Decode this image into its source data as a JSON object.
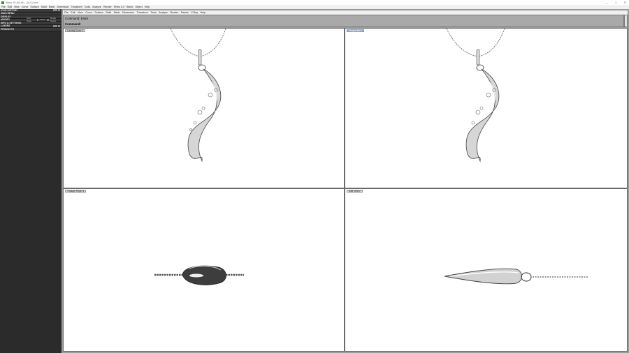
{
  "window": {
    "title": "Rhino 3D (64-bit) - [ALC] Jiem",
    "buttons": [
      "—",
      "□",
      "✕"
    ]
  },
  "top_menu": [
    "File",
    "Edit",
    "View",
    "Curve",
    "Surface",
    "Solid",
    "Mesh",
    "Dimension",
    "Transform",
    "Tools",
    "Analyze",
    "Render",
    "Rhino 5.0",
    "Blend",
    "Object",
    "Help"
  ],
  "left_panel": {
    "sections": [
      {
        "label": "ICON HISTORY"
      },
      {
        "label": "MAIN MENU"
      },
      {
        "label": "DISPLAY"
      },
      {
        "label": "MODIFY",
        "options": [
          "Grid Snap",
          "Ortho",
          "Single Snaps"
        ]
      },
      {
        "label": "INFO & SETTINGS"
      },
      {
        "label": "LAYERS"
      },
      {
        "label": "PRODUCTS"
      }
    ]
  },
  "viewport_menu": [
    "File",
    "Edit",
    "View",
    "Curve",
    "Surface",
    "Solid",
    "Mesh",
    "Dimension",
    "Transform",
    "Tools",
    "Analyze",
    "Render",
    "Panels",
    "V-Ray",
    "Help"
  ],
  "command": {
    "history": "Command: Enter",
    "prompt": "Command:"
  },
  "viewports": [
    {
      "id": "front",
      "label": "Looking Down",
      "active": false
    },
    {
      "id": "perspective",
      "label": "Perspective",
      "active": true
    },
    {
      "id": "top",
      "label": "Through Finger",
      "active": false
    },
    {
      "id": "right",
      "label": "Side View",
      "active": false
    }
  ],
  "colors": {
    "left_panel_bg": "#2b2b2b",
    "frame_bg": "#9b9b9b",
    "viewport_bg": "#ffffff",
    "active_label": "#8fa8c9"
  }
}
